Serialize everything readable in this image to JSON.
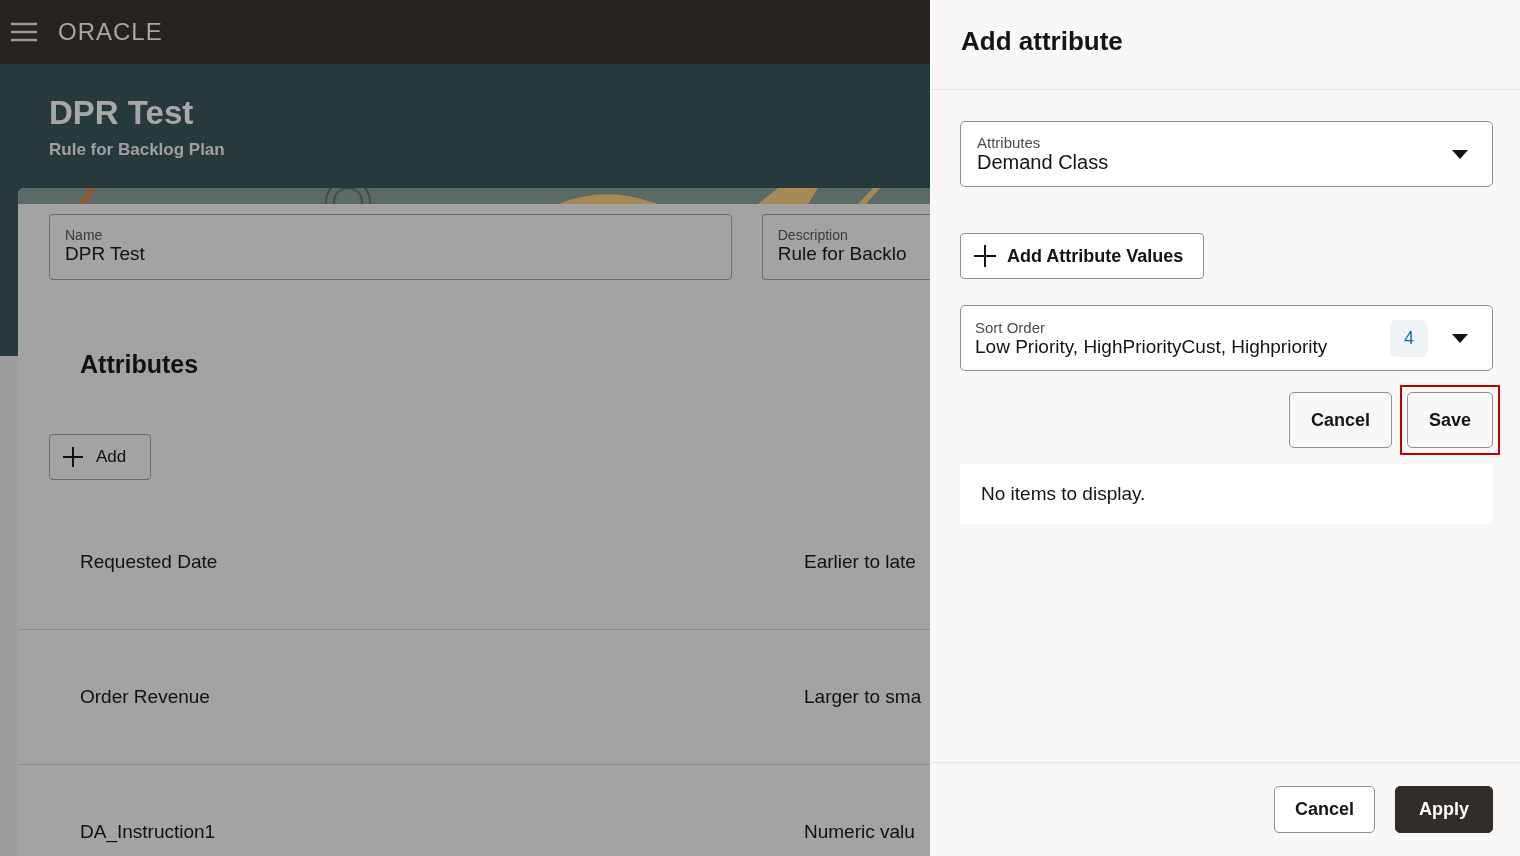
{
  "header": {
    "logo": "ORACLE"
  },
  "page": {
    "title": "DPR Test",
    "subtitle": "Rule for Backlog Plan"
  },
  "form": {
    "name": {
      "label": "Name",
      "value": "DPR Test"
    },
    "description": {
      "label": "Description",
      "value": "Rule for Backlo"
    }
  },
  "attributes": {
    "heading": "Attributes",
    "add_button": "Add",
    "rows": [
      {
        "name": "Requested Date",
        "order": "Earlier to late"
      },
      {
        "name": "Order Revenue",
        "order": "Larger to sma"
      },
      {
        "name": "DA_Instruction1",
        "order": "Numeric valu"
      }
    ]
  },
  "drawer": {
    "title": "Add attribute",
    "attribute_select": {
      "label": "Attributes",
      "value": "Demand Class"
    },
    "add_values_button": "Add Attribute Values",
    "sort_order": {
      "label": "Sort Order",
      "value": "Low Priority, HighPriorityCust, Highpriority",
      "count": "4"
    },
    "buttons": [
      {
        "label": "Cancel",
        "highlighted": false
      },
      {
        "label": "Save",
        "highlighted": true
      }
    ],
    "empty_message": "No items to display.",
    "footer_buttons": [
      {
        "label": "Cancel",
        "kind": "secondary"
      },
      {
        "label": "Apply",
        "kind": "primary"
      }
    ]
  }
}
